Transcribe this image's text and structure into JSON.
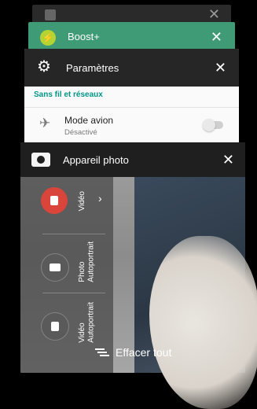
{
  "recent_apps": {
    "card_top": {
      "title": "",
      "close_icon": "✕"
    },
    "card_boost": {
      "title": "Boost+",
      "icon": "⚡",
      "close_icon": "✕"
    },
    "card_settings": {
      "title": "Paramètres",
      "gear_icon": "⚙",
      "close_icon": "✕",
      "section_title": "Sans fil et réseaux",
      "item": {
        "icon": "✈",
        "title": "Mode avion",
        "subtitle": "Désactivé",
        "toggle_on": false
      }
    },
    "card_camera": {
      "title": "Appareil photo",
      "close_icon": "✕",
      "modes": [
        {
          "label": "Vidéo",
          "active": true
        },
        {
          "label": "Photo\nAutoportrait",
          "active": false
        },
        {
          "label": "Vidéo\nAutoportrait",
          "active": false
        }
      ],
      "chevron": "›"
    },
    "clear_all_label": "Effacer tout"
  },
  "colors": {
    "boost_header": "#3f9b76",
    "settings_accent": "#009688",
    "video_mode": "#d9453a"
  }
}
